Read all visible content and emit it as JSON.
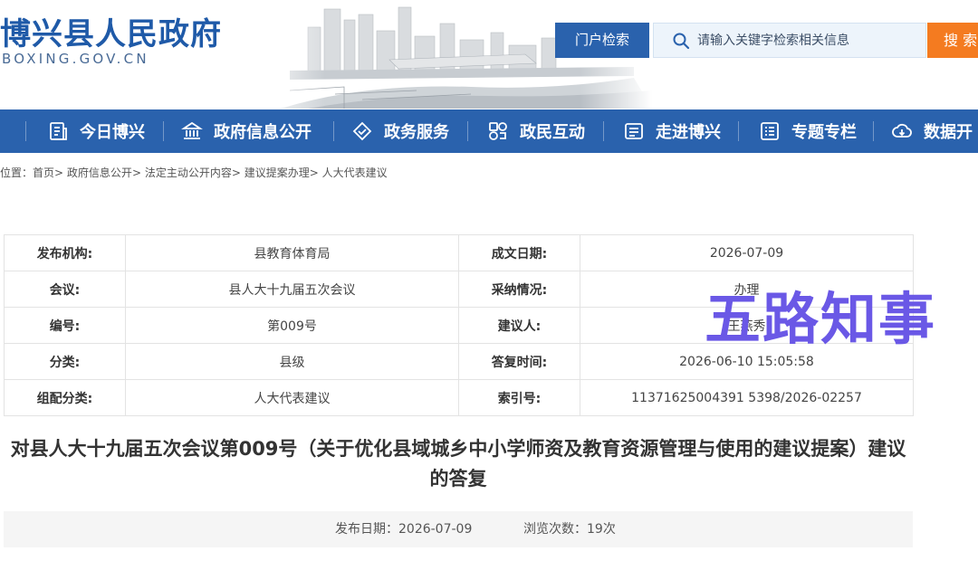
{
  "header": {
    "site_title": "博兴县人民政府",
    "site_domain": "BOXING.GOV.CN",
    "portal_search_label": "门户检索",
    "search_placeholder": "请输入关键字检索相关信息",
    "search_button_label": "搜 索"
  },
  "nav": {
    "items": [
      {
        "label": "今日博兴",
        "icon": "document-icon"
      },
      {
        "label": "政府信息公开",
        "icon": "government-building-icon"
      },
      {
        "label": "政务服务",
        "icon": "handshake-icon"
      },
      {
        "label": "政民互动",
        "icon": "interaction-icon"
      },
      {
        "label": "走进博兴",
        "icon": "id-card-icon"
      },
      {
        "label": "专题专栏",
        "icon": "list-icon"
      },
      {
        "label": "数据开",
        "icon": "cloud-download-icon"
      }
    ]
  },
  "breadcrumb": {
    "prefix": "位置：",
    "items": [
      "首页",
      "政府信息公开",
      "法定主动公开内容",
      "建议提案办理",
      "人大代表建议"
    ],
    "separator": ">"
  },
  "info_table": {
    "rows": [
      {
        "label1": "发布机构:",
        "value1": "县教育体育局",
        "label2": "成文日期:",
        "value2": "2026-07-09"
      },
      {
        "label1": "会议:",
        "value1": "县人大十九届五次会议",
        "label2": "采纳情况:",
        "value2": "办理"
      },
      {
        "label1": "编号:",
        "value1": "第009号",
        "label2": "建议人:",
        "value2": "王燕秀"
      },
      {
        "label1": "分类:",
        "value1": "县级",
        "label2": "答复时间:",
        "value2": "2026-06-10 15:05:58"
      },
      {
        "label1": "组配分类:",
        "value1": "人大代表建议",
        "label2": "索引号:",
        "value2": "11371625004391 5398/2026-02257"
      }
    ]
  },
  "watermark": {
    "text": "五路知事"
  },
  "article": {
    "title": "对县人大十九届五次会议第009号（关于优化县域城乡中小学师资及教育资源管理与使用的建议提案）建议的答复",
    "publish_date_label": "发布日期：",
    "publish_date": "2026-07-09",
    "views_label": "浏览次数：",
    "views": "19次"
  },
  "colors": {
    "brand_blue": "#2a62ad",
    "search_orange": "#f47b20",
    "watermark_purple": "#6a58e6"
  }
}
